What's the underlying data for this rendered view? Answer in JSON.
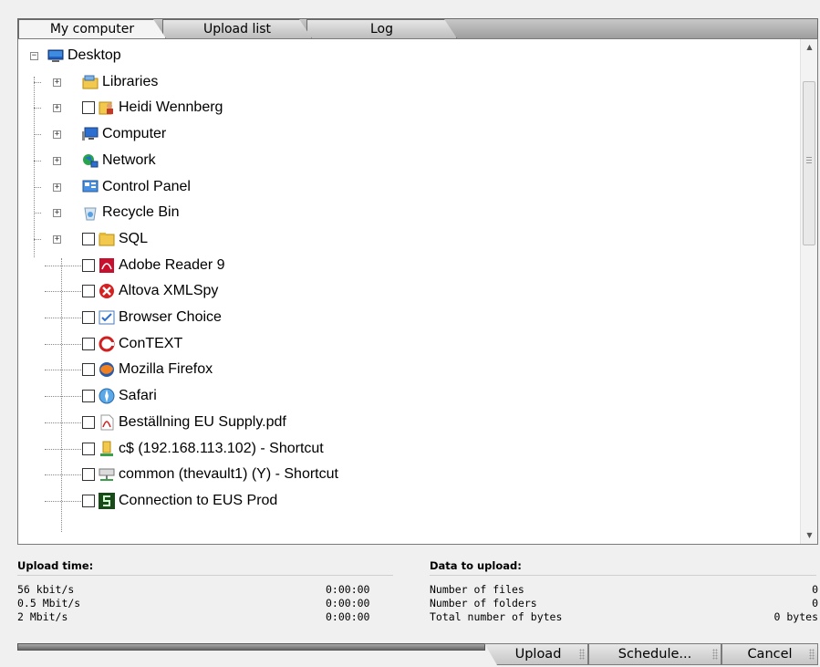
{
  "tabs": [
    {
      "label": "My computer",
      "active": true
    },
    {
      "label": "Upload list",
      "active": false
    },
    {
      "label": "Log",
      "active": false
    }
  ],
  "tree": {
    "items": [
      {
        "label": "Desktop",
        "icon": "desktop-icon",
        "expander": "minus",
        "checkbox": false
      },
      {
        "label": "Libraries",
        "icon": "libraries-icon",
        "expander": "plus",
        "checkbox": false
      },
      {
        "label": "Heidi Wennberg",
        "icon": "user-folder-icon",
        "expander": "plus",
        "checkbox": true
      },
      {
        "label": "Computer",
        "icon": "computer-icon",
        "expander": "plus",
        "checkbox": false
      },
      {
        "label": "Network",
        "icon": "network-icon",
        "expander": "plus",
        "checkbox": false
      },
      {
        "label": "Control Panel",
        "icon": "control-panel-icon",
        "expander": "plus",
        "checkbox": false
      },
      {
        "label": "Recycle Bin",
        "icon": "recycle-bin-icon",
        "expander": "plus",
        "checkbox": false
      },
      {
        "label": "SQL",
        "icon": "folder-icon",
        "expander": "plus",
        "checkbox": true
      },
      {
        "label": "Adobe Reader 9",
        "icon": "adobe-reader-icon",
        "expander": "none",
        "checkbox": true
      },
      {
        "label": "Altova XMLSpy",
        "icon": "xmlspy-icon",
        "expander": "none",
        "checkbox": true
      },
      {
        "label": "Browser Choice",
        "icon": "browser-choice-icon",
        "expander": "none",
        "checkbox": true
      },
      {
        "label": "ConTEXT",
        "icon": "context-icon",
        "expander": "none",
        "checkbox": true
      },
      {
        "label": "Mozilla Firefox",
        "icon": "firefox-icon",
        "expander": "none",
        "checkbox": true
      },
      {
        "label": "Safari",
        "icon": "safari-icon",
        "expander": "none",
        "checkbox": true
      },
      {
        "label": "Beställning EU Supply.pdf",
        "icon": "pdf-file-icon",
        "expander": "none",
        "checkbox": true
      },
      {
        "label": "c$ (192.168.113.102) - Shortcut",
        "icon": "share-shortcut-icon",
        "expander": "none",
        "checkbox": true
      },
      {
        "label": "common (thevault1) (Y) - Shortcut",
        "icon": "network-drive-icon",
        "expander": "none",
        "checkbox": true
      },
      {
        "label": "Connection to EUS Prod",
        "icon": "connection-icon",
        "expander": "none",
        "checkbox": true
      }
    ]
  },
  "summary": {
    "upload_time_label": "Upload time:",
    "data_to_upload_label": "Data to upload:",
    "speeds": [
      {
        "label": "56 kbit/s",
        "time": "0:00:00"
      },
      {
        "label": "0.5 Mbit/s",
        "time": "0:00:00"
      },
      {
        "label": "2 Mbit/s",
        "time": "0:00:00"
      }
    ],
    "stats": [
      {
        "label": "Number of files",
        "value": "0"
      },
      {
        "label": "Number of folders",
        "value": "0"
      },
      {
        "label": "Total number of bytes",
        "value": "0 bytes"
      }
    ]
  },
  "buttons": {
    "upload": "Upload",
    "schedule": "Schedule...",
    "cancel": "Cancel"
  },
  "colors": {
    "tab_active": "#f4f4f4",
    "tab_inactive": "#d2d2d2",
    "panel_bg": "#ffffff",
    "window_bg": "#f0f0f0"
  }
}
